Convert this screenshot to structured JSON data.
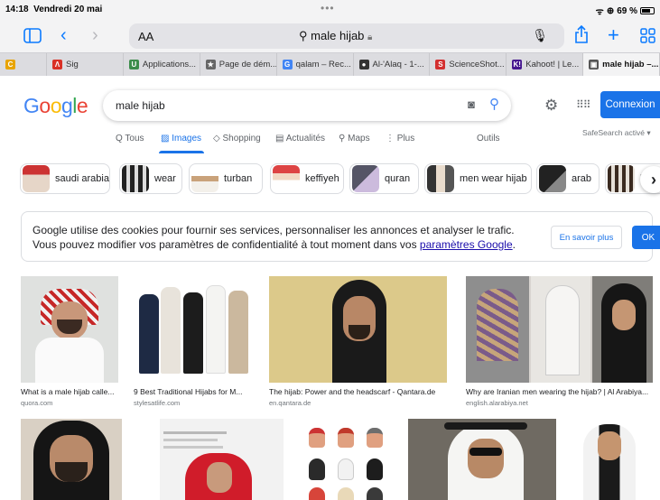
{
  "status_bar": {
    "time": "14:18",
    "date": "Vendredi 20 mai",
    "battery": "69 %",
    "wifi_icon": "wifi-icon"
  },
  "toolbar": {
    "text_size": "AA",
    "address": "male hijab",
    "lock_icon": "lock-icon",
    "mic_icon": "microphone-icon"
  },
  "tabs": [
    {
      "label": "",
      "icon": "C",
      "color": "#e8a400"
    },
    {
      "label": "Sig",
      "icon": "Λ",
      "color": "#d93025"
    },
    {
      "label": "Applications...",
      "icon": "U",
      "color": "#3c8c4a"
    },
    {
      "label": "Page de dém...",
      "icon": "★",
      "color": "#666666"
    },
    {
      "label": "qalam – Rec...",
      "icon": "G",
      "color": "#4285f4"
    },
    {
      "label": "Al-'Alaq - 1-...",
      "icon": "●",
      "color": "#333333"
    },
    {
      "label": "ScienceShot...",
      "icon": "S",
      "color": "#d32f2f"
    },
    {
      "label": "Kahoot! | Le...",
      "icon": "K!",
      "color": "#46178f"
    },
    {
      "label": "male hijab –...",
      "icon": "▣",
      "color": "#555555",
      "active": true
    }
  ],
  "google": {
    "logo": "Google",
    "query": "male hijab",
    "login_label": "Connexion",
    "nav": [
      {
        "label": "Q Tous",
        "active": false
      },
      {
        "label": "Images",
        "active": true
      },
      {
        "label": "Shopping",
        "active": false
      },
      {
        "label": "Actualités",
        "active": false
      },
      {
        "label": "Maps",
        "active": false
      },
      {
        "label": "Plus",
        "active": false
      },
      {
        "label": "Outils",
        "active": false
      }
    ],
    "safesearch": "SafeSearch activé"
  },
  "chips": [
    "saudi arabia",
    "wear",
    "turban",
    "keffiyeh",
    "quran",
    "men wear hijab",
    "arab",
    "h"
  ],
  "cookie": {
    "line1": "Google utilise des cookies pour fournir ses services, personnaliser les annonces et analyser le trafic.",
    "line2_prefix": "Vous pouvez modifier vos paramètres de confidentialité à tout moment dans vos ",
    "link": "paramètres Google",
    "line2_suffix": ".",
    "more_label": "En savoir plus",
    "ok_label": "OK"
  },
  "results": [
    {
      "caption": "What is a male hijab calle...",
      "source": "quora.com"
    },
    {
      "caption": "9 Best Traditional Hijabs for M...",
      "source": "stylesatlife.com"
    },
    {
      "caption": "The hijab: Power and the headscarf - Qantara.de",
      "source": "en.qantara.de"
    },
    {
      "caption": "Why are Iranian men wearing the hijab? | Al Arabiya...",
      "source": "english.alarabiya.net"
    }
  ]
}
